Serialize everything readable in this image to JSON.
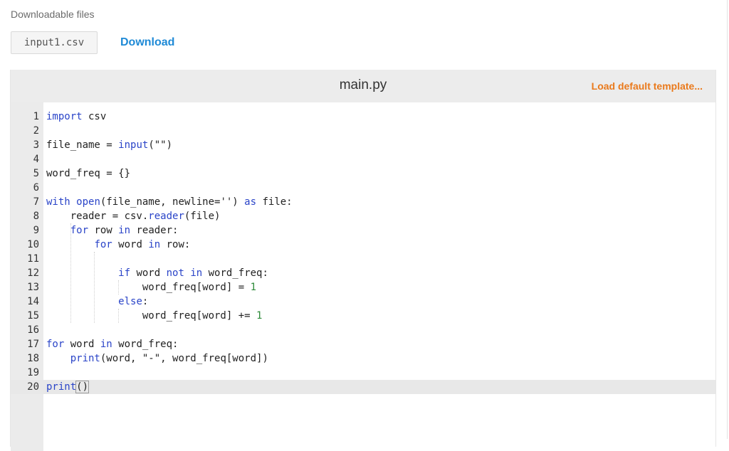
{
  "downloads": {
    "heading": "Downloadable files",
    "file_name": "input1.csv",
    "download_label": "Download"
  },
  "editor": {
    "file_title": "main.py",
    "template_label": "Load default template...",
    "active_line": 20,
    "lines": [
      "import csv",
      "",
      "file_name = input(\"\")",
      "",
      "word_freq = {}",
      "",
      "with open(file_name, newline='') as file:",
      "    reader = csv.reader(file)",
      "    for row in reader:",
      "        for word in row:",
      "",
      "            if word not in word_freq:",
      "                word_freq[word] = 1",
      "            else:",
      "                word_freq[word] += 1",
      "",
      "for word in word_freq:",
      "    print(word, \"-\", word_freq[word])",
      "",
      "print()"
    ]
  },
  "colors": {
    "link_blue": "#1f8ad6",
    "template_orange": "#ea7a1c",
    "keyword_blue": "#2a44c8",
    "number_green": "#2e8b3a"
  }
}
